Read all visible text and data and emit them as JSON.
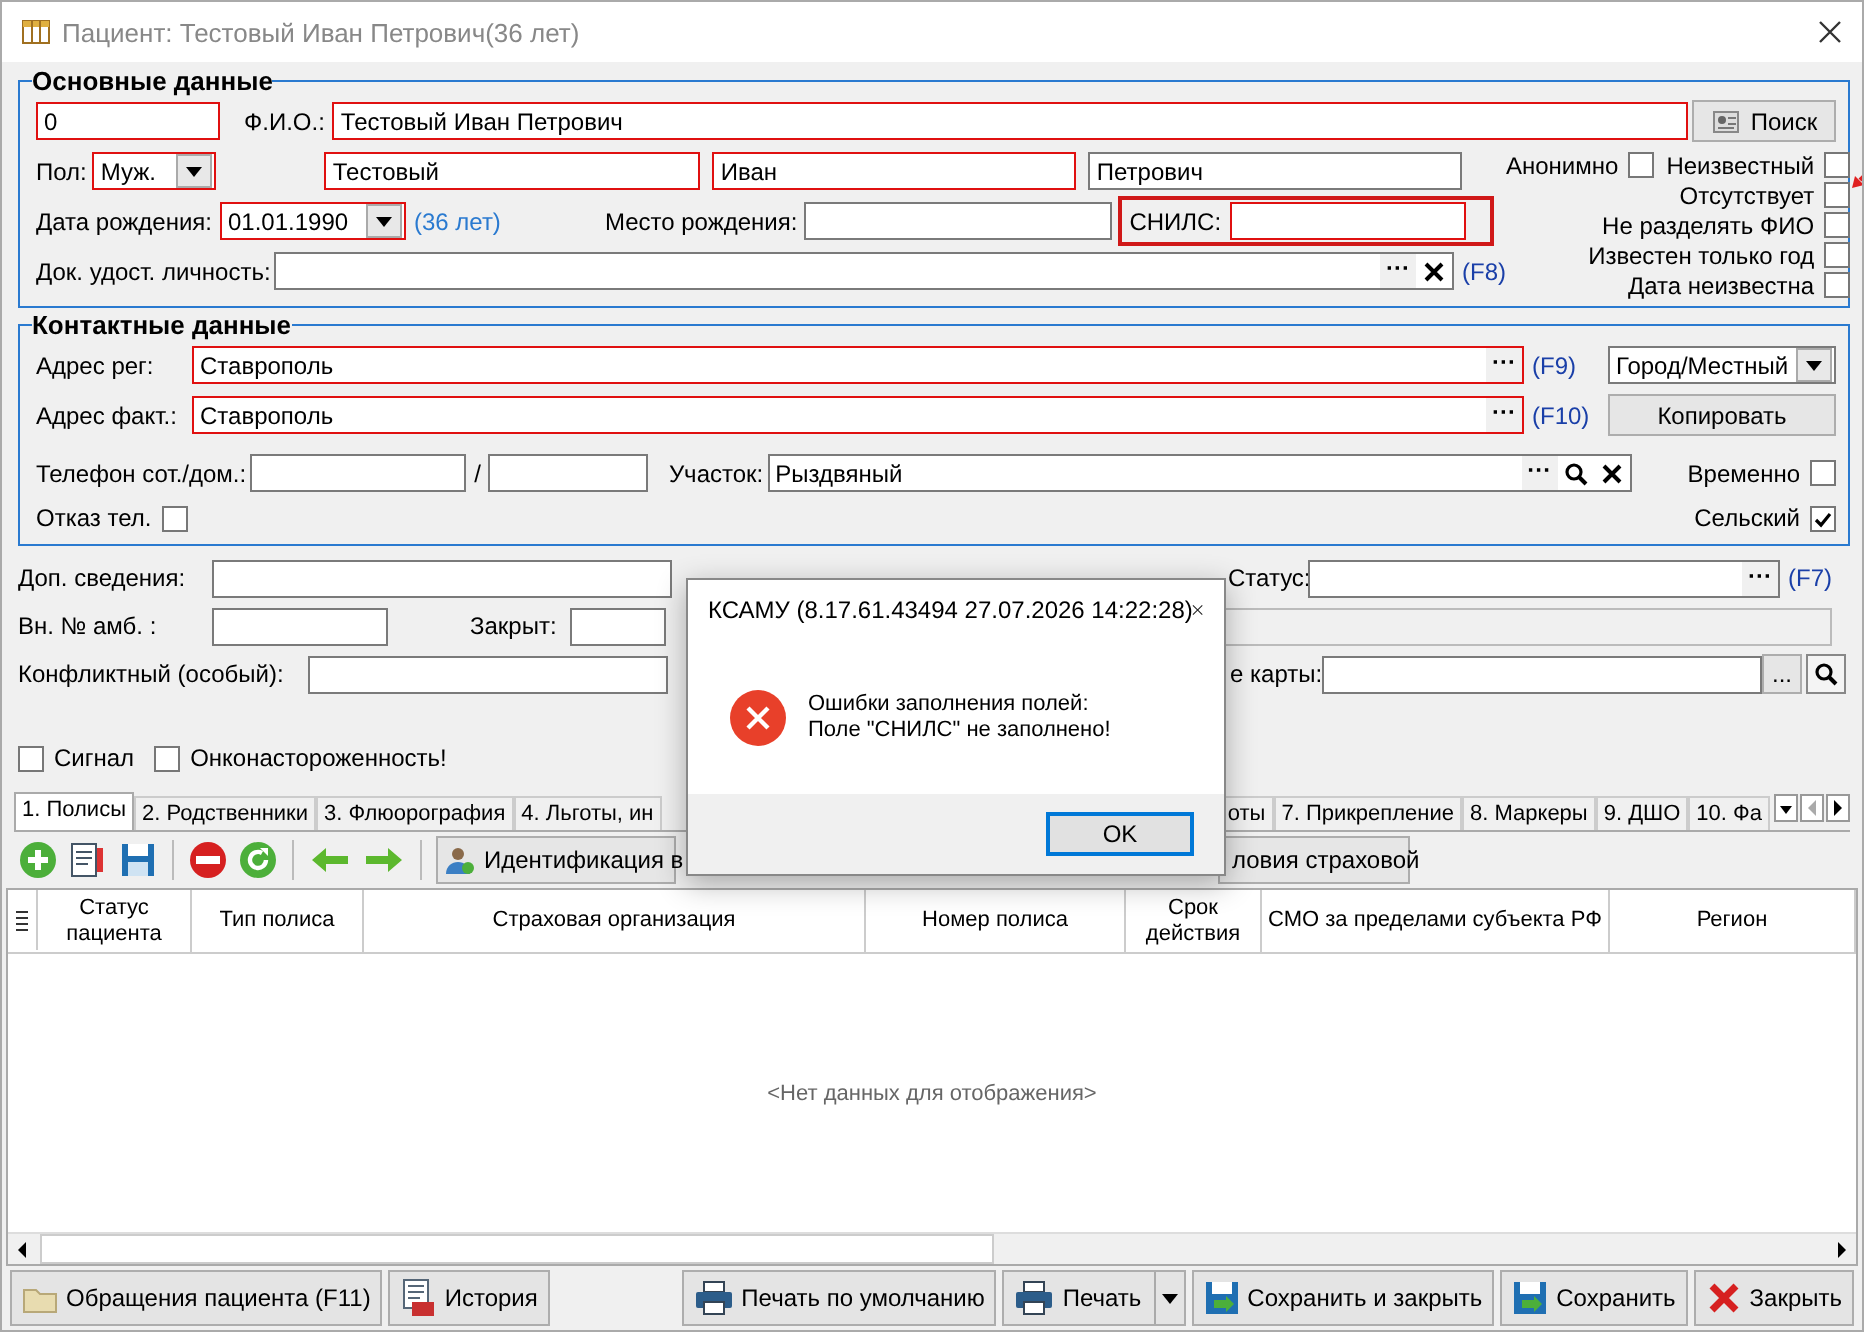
{
  "window": {
    "title": "Пациент: Тестовый Иван Петрович(36 лет)"
  },
  "main": {
    "title": "Основные данные",
    "code": {
      "value": "0",
      "required": true
    },
    "fio_label": "Ф.И.О.:",
    "fio": {
      "value": "Тестовый Иван Петрович",
      "required": true
    },
    "search_button": "Поиск",
    "sex_label": "Пол:",
    "sex": {
      "value": "Муж.",
      "required": true
    },
    "last_name": {
      "value": "Тестовый",
      "required": true
    },
    "first_name": {
      "value": "Иван",
      "required": true
    },
    "patronymic": {
      "value": "Петрович",
      "required": false
    },
    "birth_label": "Дата рождения:",
    "birth_date": {
      "value": "01.01.1990",
      "required": true
    },
    "age": "(36 лет)",
    "birthplace_label": "Место рождения:",
    "birthplace": {
      "required": false
    },
    "snils_label": "СНИЛС:",
    "snils": {
      "required": true
    },
    "doc_label": "Док. удост. личность:",
    "doc": {
      "required": false
    },
    "doc_more": "···",
    "doc_key": "(F8)",
    "flags": [
      {
        "label": "Анонимно",
        "checked": false
      },
      {
        "label": "Неизвестный",
        "checked": false
      },
      {
        "label": "Отсутствует",
        "checked": false,
        "pointer": true
      },
      {
        "label": "Не разделять ФИО",
        "checked": false
      },
      {
        "label": "Известен только год",
        "checked": false
      },
      {
        "label": "Дата неизвестна",
        "checked": false
      }
    ]
  },
  "contacts": {
    "title": "Контактные данные",
    "addresses": [
      {
        "label": "Адрес рег:",
        "value": "Ставрополь",
        "required": true,
        "more": "···",
        "key": "(F9)",
        "kind": "select",
        "side": "Город/Местный"
      },
      {
        "label": "Адрес факт.:",
        "value": "Ставрополь",
        "required": true,
        "more": "···",
        "key": "(F10)",
        "kind": "button",
        "side": "Копировать"
      }
    ],
    "phone_label": "Телефон сот./дом.:",
    "phone_sep": "/",
    "district_label": "Участок:",
    "district": "Рыздвяный",
    "district_more": "···",
    "temporary": {
      "label": "Временно",
      "checked": false
    },
    "phone_refusal": {
      "label": "Отказ тел.",
      "checked": false
    },
    "rural": {
      "label": "Сельский",
      "checked": true
    }
  },
  "extra": {
    "info_label": "Доп. сведения:",
    "status_label": "Статус:",
    "status_more": "···",
    "status_key": "(F7)",
    "amb_label": "Вн. № амб. :",
    "closed_label": "Закрыт:",
    "conflict_label": "Конфликтный (особый):",
    "card_label": "е карты:",
    "card_more": "...",
    "checks": [
      {
        "label": "Сигнал",
        "checked": false
      },
      {
        "label": "Онконастороженность!",
        "checked": false
      }
    ]
  },
  "tabs": [
    {
      "label": "1. Полисы",
      "selected": true
    },
    {
      "label": "2. Родственники",
      "selected": false
    },
    {
      "label": "3. Флюорография",
      "selected": false
    },
    {
      "label": "4. Льготы, ин",
      "selected": false
    },
    {
      "label": "оты",
      "selected": false
    },
    {
      "label": "7. Прикрепление",
      "selected": false
    },
    {
      "label": "8. Маркеры",
      "selected": false
    },
    {
      "label": "9. ДШО",
      "selected": false
    },
    {
      "label": "10. Фа",
      "selected": false
    }
  ],
  "toolbar": {
    "identify": "Идентификация в",
    "insurer": "ловия страховой"
  },
  "table": {
    "columns": [
      "Статус пациента",
      "Тип полиса",
      "Страховая организация",
      "Номер полиса",
      "Срок действия",
      "СМО за пределами субъекта РФ",
      "Регион"
    ],
    "empty": "<Нет данных для отображения>"
  },
  "buttons": {
    "visits": "Обращения пациента (F11)",
    "history": "История",
    "print_default": "Печать по умолчанию",
    "print": "Печать",
    "save_close": "Сохранить и закрыть",
    "save": "Сохранить",
    "close": "Закрыть"
  },
  "dialog": {
    "title": "КСАМУ (8.17.61.43494 27.07.2026 14:22:28)",
    "lines": [
      "Ошибки заполнения полей:",
      "Поле \"СНИЛС\" не заполнено!"
    ],
    "ok": "OK"
  }
}
